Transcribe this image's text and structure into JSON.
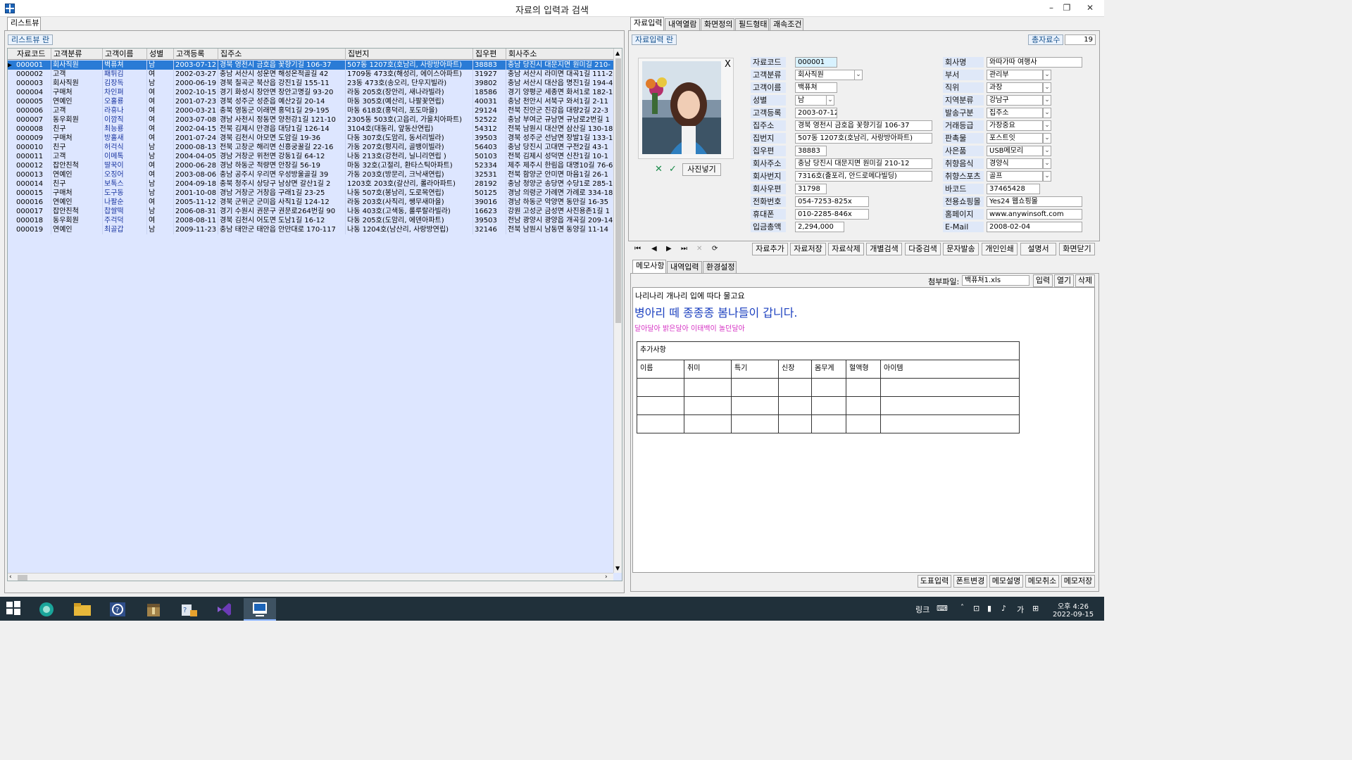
{
  "window": {
    "title": "자료의 입력과 검색",
    "controls": [
      "–",
      "❐",
      "✕"
    ]
  },
  "left": {
    "tab": "리스트뷰",
    "label": "리스트뷰 란",
    "columns": [
      "자료코드",
      "고객분류",
      "고객이름",
      "성별",
      "고객등록",
      "집주소",
      "집번지",
      "집우편",
      "회사주소"
    ],
    "rows": [
      [
        "000001",
        "회사직원",
        "벽퓨쳐",
        "남",
        "2003-07-12",
        "경북 영천시 금호읍 꽃향기길 106-37",
        "507동 1207호(호남리, 사랑방아파트)",
        "38883",
        "충남 당진시 대문지면 원미길 210-"
      ],
      [
        "000002",
        "고객",
        "패튀김",
        "여",
        "2002-03-27",
        "충남 서산시 성운면 해성온적골길 42",
        "1709동 473호(해성리, 에이스아파트)",
        "31927",
        "충남 서산시 라미면 대곡1길 111-2"
      ],
      [
        "000003",
        "회사직원",
        "김장독",
        "남",
        "2000-06-19",
        "경북 칠곡군 북산읍 강진1길 155-11",
        "23동 473호(송오리, 단우지빌라)",
        "39802",
        "충남 서산시 대산읍 명진1길 194-4"
      ],
      [
        "000004",
        "구매처",
        "차인펴",
        "여",
        "2002-10-15",
        "경기 화성시 장안면 장안고명길 93-20",
        "라동 205호(장안리, 새나라빌라)",
        "18586",
        "경기 양평군 세종면 화서1로 182-1"
      ],
      [
        "000005",
        "연예인",
        "오홀룡",
        "여",
        "2001-07-23",
        "경북 성주군 성준읍 예산2길 20-14",
        "마동 305호(예산리, 나팔꽃연립)",
        "40031",
        "충남 천안시 서북구 와서1길 2-11"
      ],
      [
        "000006",
        "고객",
        "라휴나",
        "여",
        "2000-03-21",
        "충북 영동군 이래면 홍덕1길 29-195",
        "마동 618호(홍덕리, 포도마을)",
        "29124",
        "전북 진안군 진강읍 대량2길 22-3"
      ],
      [
        "000007",
        "동우회원",
        "이깜직",
        "여",
        "2003-07-08",
        "경남 사천시 정동면 양천강1길 121-10",
        "2305동 503호(고읍리, 가을치아파트)",
        "52522",
        "충남 부여군 규남면 규남로2번길 1"
      ],
      [
        "000008",
        "친구",
        "최능룡",
        "여",
        "2002-04-15",
        "전북 김제시 만경읍 대당1길 126-14",
        "3104호(대동리, 앞동산연립)",
        "54312",
        "전북 남원시 대산면 삼산길 130-18"
      ],
      [
        "000009",
        "구매처",
        "방홀새",
        "여",
        "2001-07-24",
        "경북 김천시 아모면 도암길 19-36",
        "다동 307호(도암리, 동서리빌라)",
        "39503",
        "경북 성주군 선남면 장발1길 133-1"
      ],
      [
        "000010",
        "친구",
        "허걱식",
        "남",
        "2000-08-13",
        "전북 고창군 해리면 신흥궁꿀길 22-16",
        "가동 207호(평지리, 골뱅이빌라)",
        "56403",
        "충남 당진시 고대면 구전2길 43-1"
      ],
      [
        "000011",
        "고객",
        "이메톡",
        "남",
        "2004-04-05",
        "경남 거창군 위천면 강동1길 64-12",
        "나동 213호(강천리, 닐니리연립 )",
        "50103",
        "전북 김제시 성덕면 신찬1길 10-1"
      ],
      [
        "000012",
        "잡안친척",
        "딸꾹이",
        "여",
        "2000-06-28",
        "경남 하동군 적량면 안장길 56-19",
        "마동 32호(고절리, 환타스틱아파트)",
        "52334",
        "제주 제주시 한림읍 대명10길 76-6"
      ],
      [
        "000013",
        "연예인",
        "오징어",
        "여",
        "2003-08-06",
        "충남 공주시 우리면 우성방울골길 39",
        "가동 203호(방문리, 크낙새연립)",
        "32531",
        "전북 함양군 안미면 마음1길 26-1"
      ],
      [
        "000014",
        "친구",
        "보톡스",
        "남",
        "2004-09-18",
        "충북 청주시 상당구 남상면 갈산1길 2",
        "1203호 203호(갈산리, 롤라아파트)",
        "28192",
        "충남 청양군 송당면 수당1로 285-1"
      ],
      [
        "000015",
        "구매처",
        "도구동",
        "남",
        "2001-10-08",
        "경남 거창군 거창읍 구래1길 23-25",
        "나동 507호(봉남리, 도로목연립)",
        "50125",
        "경남 의령군 가례면 가례로 334-18"
      ],
      [
        "000016",
        "연예인",
        "나팔순",
        "여",
        "2005-11-12",
        "경북 군위군 군미읍 사직1길 124-12",
        "라동 203호(사직리, 쌩무새마을)",
        "39016",
        "경남 하동군 악양면 동만길 16-35"
      ],
      [
        "000017",
        "잡안친척",
        "찹쌀떡",
        "남",
        "2006-08-31",
        "경기 수원시 권문구 권문로264번길 90",
        "나동 403호(고색동, 룰루랄라빌라)",
        "16623",
        "강원 고성군 금성면 사진용존1길 1"
      ],
      [
        "000018",
        "동우회원",
        "주걱덕",
        "여",
        "2008-08-11",
        "경북 김천시 어도면 도남1길 16-12",
        "다동 205호(도암리, 에덴아파트)",
        "39503",
        "전남 광양시 광양읍 개곡길 209-14"
      ],
      [
        "000019",
        "연예인",
        "최골갑",
        "남",
        "2009-11-23",
        "충남 태안군 태안읍 안만대로 170-117",
        "나동 1204호(남산리, 사랑방연립)",
        "32146",
        "전북 남원시 남동면 동양길 11-14"
      ]
    ]
  },
  "right": {
    "tabs": [
      "자료입력",
      "내역열람",
      "화면정의",
      "필드형태",
      "괘속조건"
    ],
    "label": "자료입력 란",
    "total_label": "총자료수",
    "total_value": "19",
    "photo_close": "X",
    "photo_button": "사진넣기",
    "fields_left": [
      {
        "label": "자료코드",
        "value": "000001"
      },
      {
        "label": "고객분류",
        "value": "회사직원"
      },
      {
        "label": "고객이름",
        "value": "백퓨쳐"
      },
      {
        "label": "성별",
        "value": "남"
      },
      {
        "label": "고객등록",
        "value": "2003-07-12"
      },
      {
        "label": "집주소",
        "value": "경북 영천시 금호읍 꽃향기길 106-37"
      },
      {
        "label": "집번지",
        "value": "507동 1207호(호남리, 사랑방아파트)"
      },
      {
        "label": "집우편",
        "value": "38883"
      },
      {
        "label": "회사주소",
        "value": "충남 당진시 대문지면 원미길 210-12"
      },
      {
        "label": "회사번지",
        "value": "7316호(출포리, 안드로메다빌딩)"
      },
      {
        "label": "회사우편",
        "value": "31798"
      },
      {
        "label": "전화번호",
        "value": "054-7253-825x"
      },
      {
        "label": "휴대폰",
        "value": "010-2285-846x"
      },
      {
        "label": "입금총액",
        "value": "2,294,000"
      }
    ],
    "fields_right": [
      {
        "label": "회사명",
        "value": "와따가따 여행사"
      },
      {
        "label": "부서",
        "value": "관리부"
      },
      {
        "label": "직위",
        "value": "과장"
      },
      {
        "label": "지역분류",
        "value": "강남구"
      },
      {
        "label": "발송구분",
        "value": "집주소"
      },
      {
        "label": "거래등급",
        "value": "가장중요"
      },
      {
        "label": "판촉물",
        "value": "포스트잇"
      },
      {
        "label": "사은품",
        "value": "USB메모리"
      },
      {
        "label": "취향음식",
        "value": "경양식"
      },
      {
        "label": "취향스포츠",
        "value": "골프"
      },
      {
        "label": "바코드",
        "value": "37465428"
      },
      {
        "label": "전용쇼핑몰",
        "value": "Yes24 웹쇼핑몰"
      },
      {
        "label": "홈페이지",
        "value": "www.anywinsoft.com"
      },
      {
        "label": "E-Mail",
        "value": "2008-02-04"
      }
    ],
    "nav": [
      "⏮",
      "◀",
      "▶",
      "⏭",
      "✕",
      "⟳"
    ],
    "actions": [
      "자료추가",
      "자료저장",
      "자료삭제",
      "개별검색",
      "다중검색",
      "문자발송",
      "개인인쇄",
      "설명서",
      "화면닫기"
    ],
    "memo_tabs": [
      "메모사항",
      "내역입력",
      "환경설정"
    ],
    "attach_label": "첨부파일:",
    "attach_value": "백퓨쳐1.xls",
    "attach_buttons": [
      "입력",
      "열기",
      "삭제"
    ],
    "memo_line1": "나리나리 개나리 입에 따다 물고요",
    "memo_line2": "병아리 떼 종종종 봄나들이 갑니다.",
    "memo_line3": "달아달아 밝은달아 이태백이 놀던달아",
    "memo_table_title": "추가사항",
    "memo_table_cols": [
      "이름",
      "취미",
      "특기",
      "신장",
      "몸무게",
      "혈액형",
      "아이템"
    ],
    "bottom_buttons": [
      "도표입력",
      "폰트변경",
      "메모설명",
      "메모취소",
      "메모저장"
    ]
  },
  "taskbar": {
    "link_label": "링크",
    "time": "오후 4:26",
    "date": "2022-09-15",
    "ime": "가"
  },
  "colors": {
    "selection": "#2a7bd6",
    "grid_bg": "#dde6ff",
    "name_text": "#1b36a0",
    "memo_blue": "#1a3fbf",
    "memo_pink": "#d633c4"
  }
}
